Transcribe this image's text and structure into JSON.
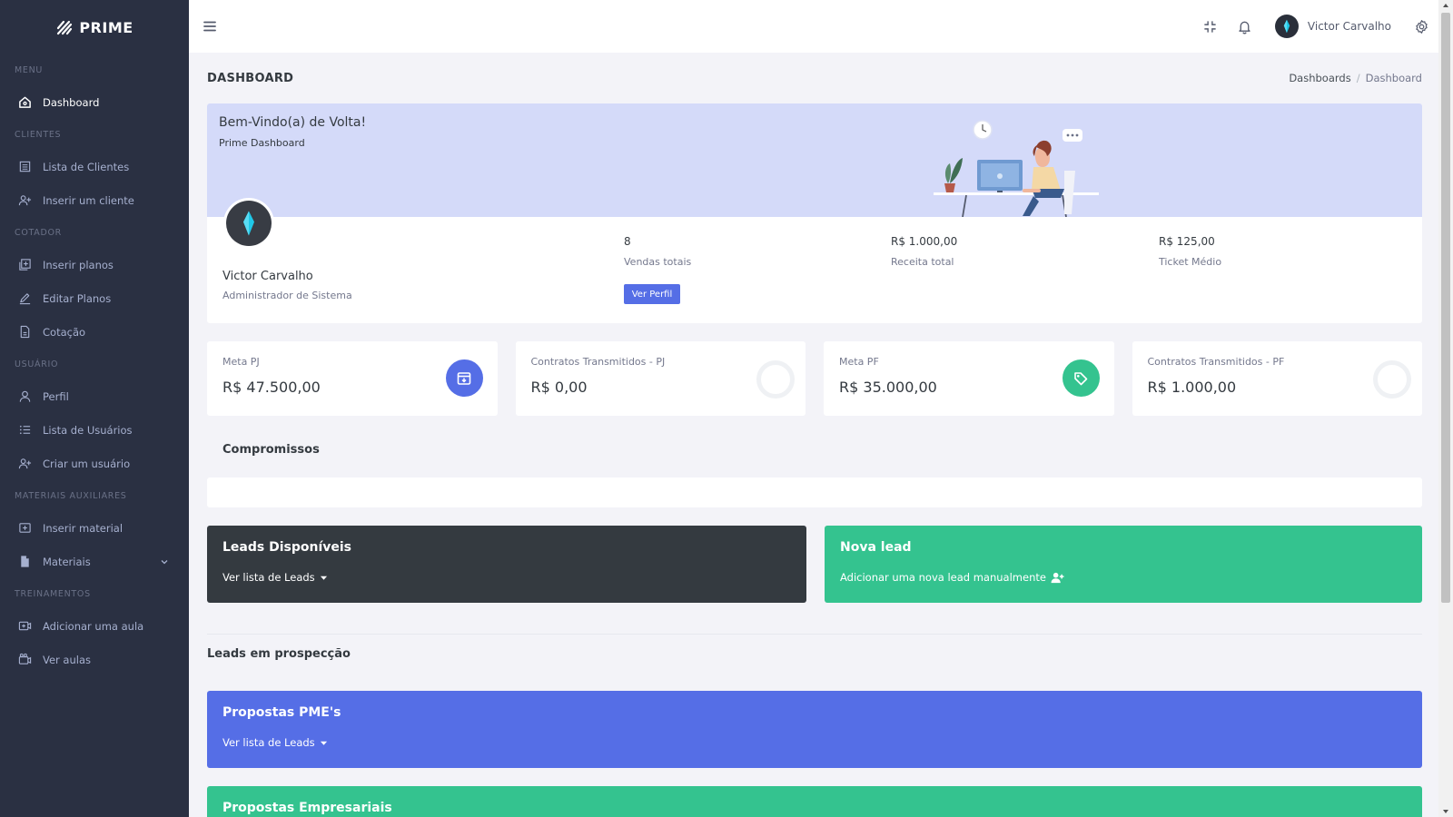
{
  "brand": {
    "name": "PRIME"
  },
  "sidebar": {
    "sections": [
      {
        "title": "MENU",
        "items": [
          {
            "label": "Dashboard",
            "icon": "home-icon",
            "active": true
          }
        ]
      },
      {
        "title": "CLIENTES",
        "items": [
          {
            "label": "Lista de Clientes",
            "icon": "list-icon"
          },
          {
            "label": "Inserir um cliente",
            "icon": "user-plus-icon"
          }
        ]
      },
      {
        "title": "COTADOR",
        "items": [
          {
            "label": "Inserir planos",
            "icon": "add-square-icon"
          },
          {
            "label": "Editar Planos",
            "icon": "edit-icon"
          },
          {
            "label": "Cotação",
            "icon": "document-icon"
          }
        ]
      },
      {
        "title": "USUÁRIO",
        "items": [
          {
            "label": "Perfil",
            "icon": "user-icon"
          },
          {
            "label": "Lista de Usuários",
            "icon": "list-bullet-icon"
          },
          {
            "label": "Criar um usuário",
            "icon": "user-plus-icon"
          }
        ]
      },
      {
        "title": "MATERIAIS AUXILIARES",
        "items": [
          {
            "label": "Inserir material",
            "icon": "add-box-icon"
          },
          {
            "label": "Materiais",
            "icon": "file-icon",
            "caret": true
          }
        ]
      },
      {
        "title": "TREINAMENTOS",
        "items": [
          {
            "label": "Adicionar uma aula",
            "icon": "video-add-icon"
          },
          {
            "label": "Ver aulas",
            "icon": "video-icon"
          }
        ]
      }
    ]
  },
  "topbar": {
    "user_name": "Victor Carvalho"
  },
  "page": {
    "title": "DASHBOARD",
    "breadcrumb": [
      "Dashboards",
      "Dashboard"
    ]
  },
  "welcome": {
    "title": "Bem-Vindo(a) de Volta!",
    "subtitle": "Prime Dashboard",
    "profile_name": "Victor Carvalho",
    "profile_role": "Administrador de Sistema",
    "stats": [
      {
        "value": "8",
        "label": "Vendas totais"
      },
      {
        "value": "R$ 1.000,00",
        "label": "Receita total"
      },
      {
        "value": "R$ 125,00",
        "label": "Ticket Médio"
      }
    ],
    "button": "Ver Perfil"
  },
  "mini_cards": [
    {
      "label": "Meta PJ",
      "value": "R$ 47.500,00",
      "icon": "archive-icon",
      "color": "#556ee6"
    },
    {
      "label": "Contratos Transmitidos - PJ",
      "value": "R$ 0,00",
      "icon": "ring"
    },
    {
      "label": "Meta PF",
      "value": "R$ 35.000,00",
      "icon": "tag-icon",
      "color": "#34c38f"
    },
    {
      "label": "Contratos Transmitidos - PF",
      "value": "R$ 1.000,00",
      "icon": "ring"
    }
  ],
  "compromissos": {
    "title": "Compromissos"
  },
  "leads_disponiveis": {
    "title": "Leads Disponíveis",
    "link": "Ver lista de Leads"
  },
  "nova_lead": {
    "title": "Nova lead",
    "link": "Adicionar uma nova lead manualmente"
  },
  "prospeccao": {
    "title": "Leads em prospecção"
  },
  "propostas_pme": {
    "title": "Propostas PME's",
    "link": "Ver lista de Leads"
  },
  "propostas_empresariais": {
    "title": "Propostas Empresariais"
  },
  "colors": {
    "sidebar": "#2a3042",
    "primary": "#556ee6",
    "success": "#34c38f",
    "dark": "#343a40",
    "welcome_bg": "#d4daf9"
  }
}
